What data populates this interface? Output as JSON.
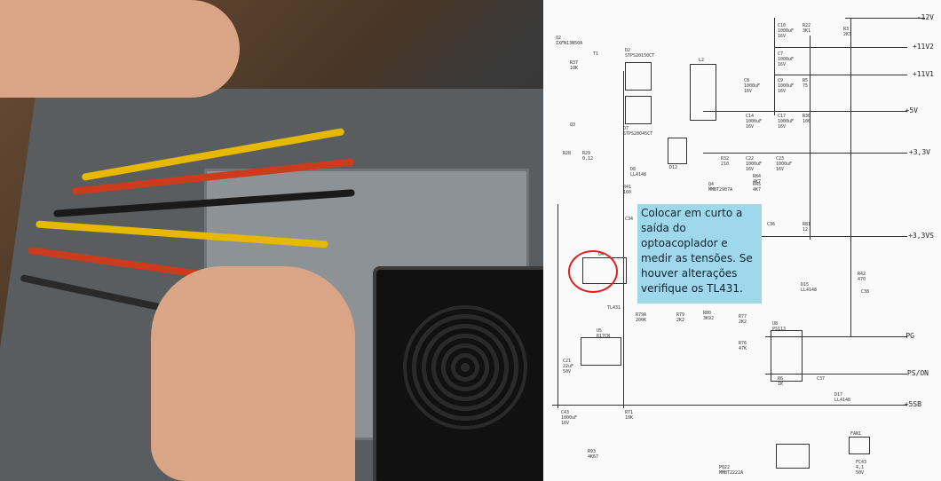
{
  "annotation": {
    "text": "Colocar em curto a saída do optoacoplador e medir as tensões. Se houver alterações verifique os TL431."
  },
  "rails": [
    {
      "label": "-12V"
    },
    {
      "label": "+11V2"
    },
    {
      "label": "+11V1"
    },
    {
      "label": "+5V"
    },
    {
      "label": "+3,3V"
    },
    {
      "label": "+3,3VS"
    },
    {
      "label": "PG"
    },
    {
      "label": "PS/ON"
    },
    {
      "label": "+5SB"
    }
  ],
  "components": {
    "q2": "Q2\nIXFN13N50A",
    "r37": "R37\n10K",
    "t1": "T1",
    "d2": "D2\nSTPS20150CT",
    "d7": "D7\nSTPS20045CT",
    "l2": "L2",
    "q3": "Q3",
    "r28": "R28",
    "r29": "R29\n0,12",
    "d8": "D8\nLL4148",
    "r41": "R41\n160",
    "d12": "D12",
    "q4": "Q4\nMMBT2907A",
    "r45": "R45\n4K7",
    "c34": "C34",
    "c36": "C36",
    "r81": "R81\n12",
    "u4": "U4",
    "d15": "D15\nLL4148",
    "r42": "R42\n470",
    "c38": "C38",
    "tl431": "TL431",
    "r79a": "R79A\n200K",
    "r79": "R79\n2K2",
    "r80": "R80\n3K92",
    "r77": "R77\n2K2",
    "r76": "R76\n47K",
    "u5": "U5\nR17CN",
    "c21": "C21\n22uF\n50V",
    "u8": "U8\nPS113",
    "r6": "R6\n1K",
    "c37": "C37",
    "d17": "D17\nLL4148",
    "c43": "C43\n1000uF\n16V",
    "r71": "R71\n10K",
    "r93": "R93\n4K67",
    "fan1": "FAN1",
    "q22": "PQ22\nMMBT2222A",
    "fc43": "FC43\n4,1\n50V",
    "r10": "C10\n1000uF\n16V",
    "r22": "R22\n3K1",
    "r3": "R3\n2K3",
    "c7": "C7\n1000uF\n16V",
    "c8": "C8\n1000uF\n16V",
    "c9": "C9\n1000uF\n16V",
    "r5": "R5\n75",
    "c14": "C14\n1000uF\n16V",
    "c17": "C17\n1000uF\n16V",
    "r30": "R30\n100",
    "c22": "C22\n1000uF\n16V",
    "c23": "C23\n1000uF\n16V",
    "r32": "R32\n210",
    "r84": "R84\n4K7"
  },
  "colors": {
    "note_bg": "#9fd8ea",
    "circle": "#e02020"
  }
}
